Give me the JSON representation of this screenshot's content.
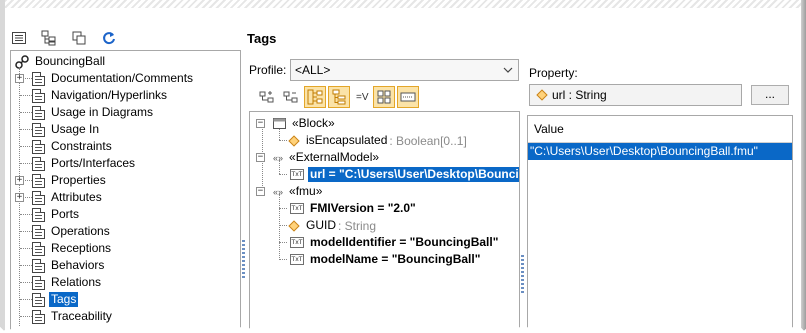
{
  "toolbar": {
    "buttons": [
      {
        "name": "list-view-icon"
      },
      {
        "name": "tree-view-icon"
      },
      {
        "name": "copy-icon"
      },
      {
        "name": "refresh-icon"
      }
    ]
  },
  "left_tree": {
    "root": "BouncingBall",
    "items": [
      {
        "label": "Documentation/Comments",
        "expandable": true
      },
      {
        "label": "Navigation/Hyperlinks",
        "expandable": false
      },
      {
        "label": "Usage in Diagrams",
        "expandable": false
      },
      {
        "label": "Usage In",
        "expandable": false
      },
      {
        "label": "Constraints",
        "expandable": false
      },
      {
        "label": "Ports/Interfaces",
        "expandable": false
      },
      {
        "label": "Properties",
        "expandable": true
      },
      {
        "label": "Attributes",
        "expandable": true
      },
      {
        "label": "Ports",
        "expandable": false
      },
      {
        "label": "Operations",
        "expandable": false
      },
      {
        "label": "Receptions",
        "expandable": false
      },
      {
        "label": "Behaviors",
        "expandable": false
      },
      {
        "label": "Relations",
        "expandable": false
      },
      {
        "label": "Tags",
        "expandable": false,
        "selected": true
      },
      {
        "label": "Traceability",
        "expandable": false
      }
    ]
  },
  "main": {
    "title": "Tags",
    "profile_label": "Profile:",
    "profile_value": "<ALL>",
    "filter_text": "=V"
  },
  "tags_tree": {
    "block": "«Block»",
    "is_encapsulated_name": "isEncapsulated",
    "is_encapsulated_type": " : Boolean[0..1]",
    "external_model": "«ExternalModel»",
    "url_value": "url = \"C:\\Users\\User\\Desktop\\Bouncin",
    "fmu": "«fmu»",
    "fmi_version": "FMIVersion = \"2.0\"",
    "guid_name": "GUID",
    "guid_type": " : String",
    "model_identifier": "modelIdentifier = \"BouncingBall\"",
    "model_name": "modelName = \"BouncingBall\"",
    "stereo_symbol": "«»",
    "txt_icon": "TxT"
  },
  "property": {
    "label": "Property:",
    "value": "url : String",
    "button": "..."
  },
  "value_table": {
    "header": "Value",
    "cell": "\"C:\\Users\\User\\Desktop\\BouncingBall.fmu\""
  }
}
